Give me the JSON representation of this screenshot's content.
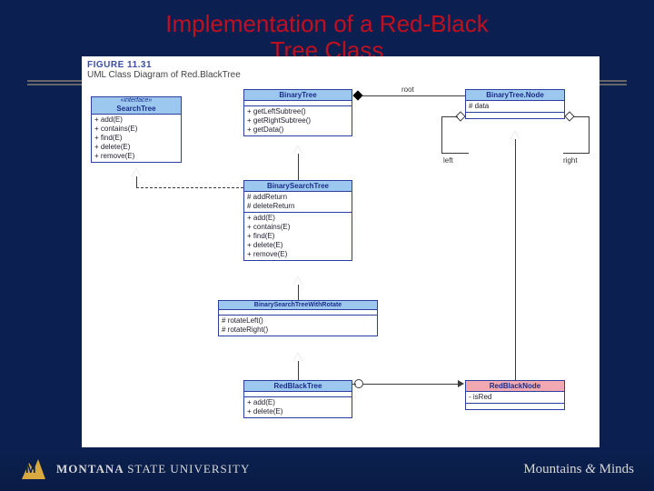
{
  "title_line1": "Implementation of a Red-Black",
  "title_line2": "Tree Class",
  "figure": {
    "num": "FIGURE 11.31",
    "caption": "UML Class Diagram of Red.BlackTree"
  },
  "searchtree": {
    "stereo": "«interface»",
    "name": "SearchTree",
    "m1": "+ add(E)",
    "m2": "+ contains(E)",
    "m3": "+ find(E)",
    "m4": "+ delete(E)",
    "m5": "+ remove(E)"
  },
  "binarytree": {
    "name": "BinaryTree",
    "m1": "+ getLeftSubtree()",
    "m2": "+ getRightSubtree()",
    "m3": "+ getData()"
  },
  "btnode": {
    "name": "BinaryTree.Node",
    "f1": "# data"
  },
  "bst": {
    "name": "BinarySearchTree",
    "f1": "# addReturn",
    "f2": "# deleteReturn",
    "m1": "+ add(E)",
    "m2": "+ contains(E)",
    "m3": "+ find(E)",
    "m4": "+ delete(E)",
    "m5": "+ remove(E)"
  },
  "bstrot": {
    "name": "BinarySearchTreeWithRotate",
    "m1": "# rotateLeft()",
    "m2": "# rotateRight()"
  },
  "rbt": {
    "name": "RedBlackTree",
    "m1": "+ add(E)",
    "m2": "+ delete(E)"
  },
  "rbn": {
    "name": "RedBlackNode",
    "f1": "- isRed"
  },
  "labels": {
    "root": "root",
    "left": "left",
    "right": "right"
  },
  "footer": {
    "uni1": "MONTANA ",
    "uni2": "STATE UNIVERSITY",
    "tag1": "Mountains ",
    "amp": "&",
    "tag2": " Minds"
  }
}
